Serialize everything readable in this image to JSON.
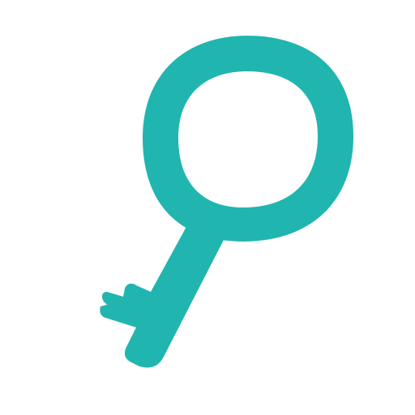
{
  "icon": {
    "name": "key-icon",
    "color": "#21B5B0",
    "background": "#FFFFFF"
  }
}
